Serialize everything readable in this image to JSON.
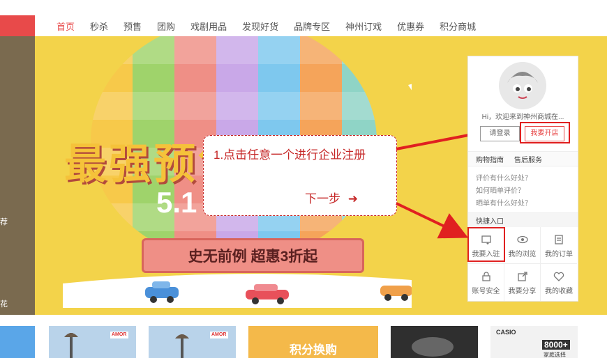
{
  "nav": {
    "items": [
      "首页",
      "秒杀",
      "预售",
      "团购",
      "戏剧用品",
      "发现好货",
      "品牌专区",
      "神州订戏",
      "优惠券",
      "积分商城"
    ],
    "active_color": "#e84a4a"
  },
  "left_strip": {
    "text_1": "荐",
    "text_2": "花"
  },
  "banner": {
    "hero_title": "最强预售节",
    "date": "5.1",
    "promo": "史无前例 超惠3折起",
    "background": "#f3d34a"
  },
  "callout": {
    "text": "1.点击任意一个进行企业注册",
    "next": "下一步"
  },
  "panel": {
    "greeting": "Hi，欢迎来到神州商城在...",
    "login_label": "请登录",
    "open_store_label": "我要开店",
    "tabs": [
      "购物指南",
      "售后服务"
    ],
    "faq": [
      "评价有什么好处？",
      "如何晒单评价？",
      "晒单有什么好处？"
    ],
    "shortcut_title": "快捷入口",
    "shortcuts": [
      {
        "label": "我要入驻",
        "icon": "store-entry-icon"
      },
      {
        "label": "我的浏览",
        "icon": "eye-icon"
      },
      {
        "label": "我的订单",
        "icon": "order-list-icon"
      },
      {
        "label": "账号安全",
        "icon": "lock-icon"
      },
      {
        "label": "我要分享",
        "icon": "share-icon"
      },
      {
        "label": "我的收藏",
        "icon": "heart-icon"
      }
    ]
  },
  "cards": {
    "points_label": "积分换购",
    "brand_1": "AMOR",
    "brand_2": "CASIO",
    "promo_tag": "8000+",
    "promo_sub": "家庭选择"
  },
  "colors": {
    "accent": "#e84a4a",
    "annotation_red": "#e02020"
  }
}
